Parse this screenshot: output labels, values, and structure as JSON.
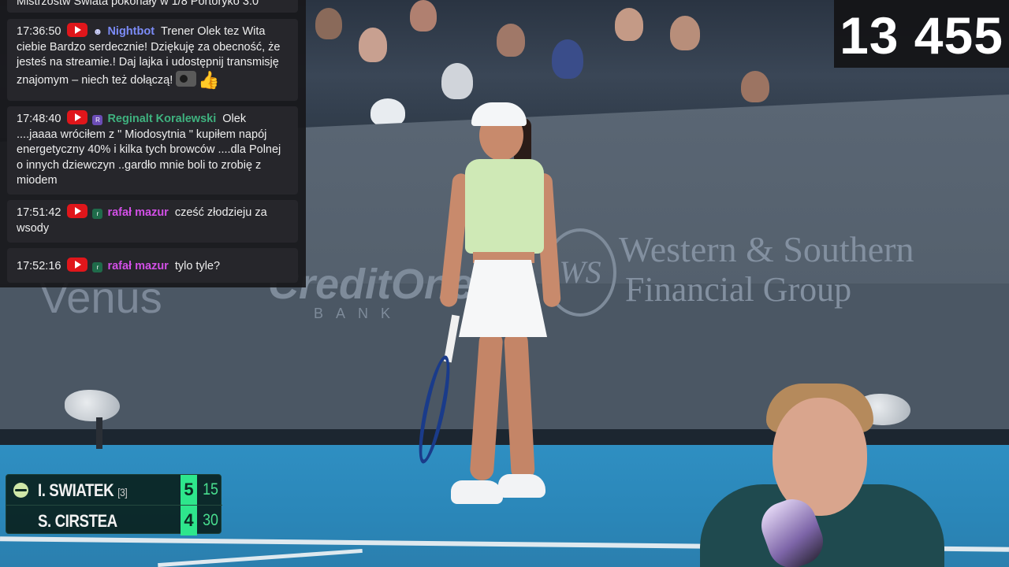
{
  "chat": {
    "top_partial": "Mistrzostw Świata pokonały w 1/8 Portoryko 3:0",
    "messages": [
      {
        "time": "17:36:50",
        "user": "Nightbot",
        "user_color": "#7c8cf8",
        "text": "Trener Olek tez Wita ciebie Bardzo serdecznie! Dziękuję za obecność, że jesteś na streamie.! Daj lajka i udostępnij transmisję znajomym – niech też dołączą!"
      },
      {
        "time": "17:48:40",
        "user": "Reginalt Koralewski",
        "user_color": "#3fb27f",
        "badge": "R",
        "text": "Olek ....jaaaa wróciłem z \" Miodosytnia \" kupiłem napój energetyczny 40% i kilka tych browców ....dla Polnej o innych dziewczyn ..gardło mnie boli to zrobię z miodem"
      },
      {
        "time": "17:51:42",
        "user": "rafał mazur",
        "user_color": "#d24fe6",
        "badge": "r",
        "text": "cześć złodzieju za wsody"
      },
      {
        "time": "17:52:16",
        "user": "rafał mazur",
        "user_color": "#d24fe6",
        "badge": "r",
        "text": "tylo tyle?"
      }
    ]
  },
  "viewers": {
    "count": "13 455"
  },
  "scoreboard": {
    "players": [
      {
        "name": "I. SWIATEK",
        "seed": "[3]",
        "games": "5",
        "points": "15",
        "serving": true
      },
      {
        "name": "S. CIRSTEA",
        "seed": "",
        "games": "4",
        "points": "30",
        "serving": false
      }
    ]
  },
  "sponsors": {
    "left": "Venus",
    "middle": "CreditOne",
    "middle_sub": "BANK",
    "right_logo": "WS",
    "right_line1": "Western & Southern",
    "right_line2": "Financial Group"
  },
  "colors": {
    "youtube_red": "#e0161b",
    "games_green": "#2ee68c",
    "court_blue": "#2f8fc2"
  },
  "icons": {
    "platform": "youtube-icon",
    "serve": "tennis-ball-icon"
  }
}
